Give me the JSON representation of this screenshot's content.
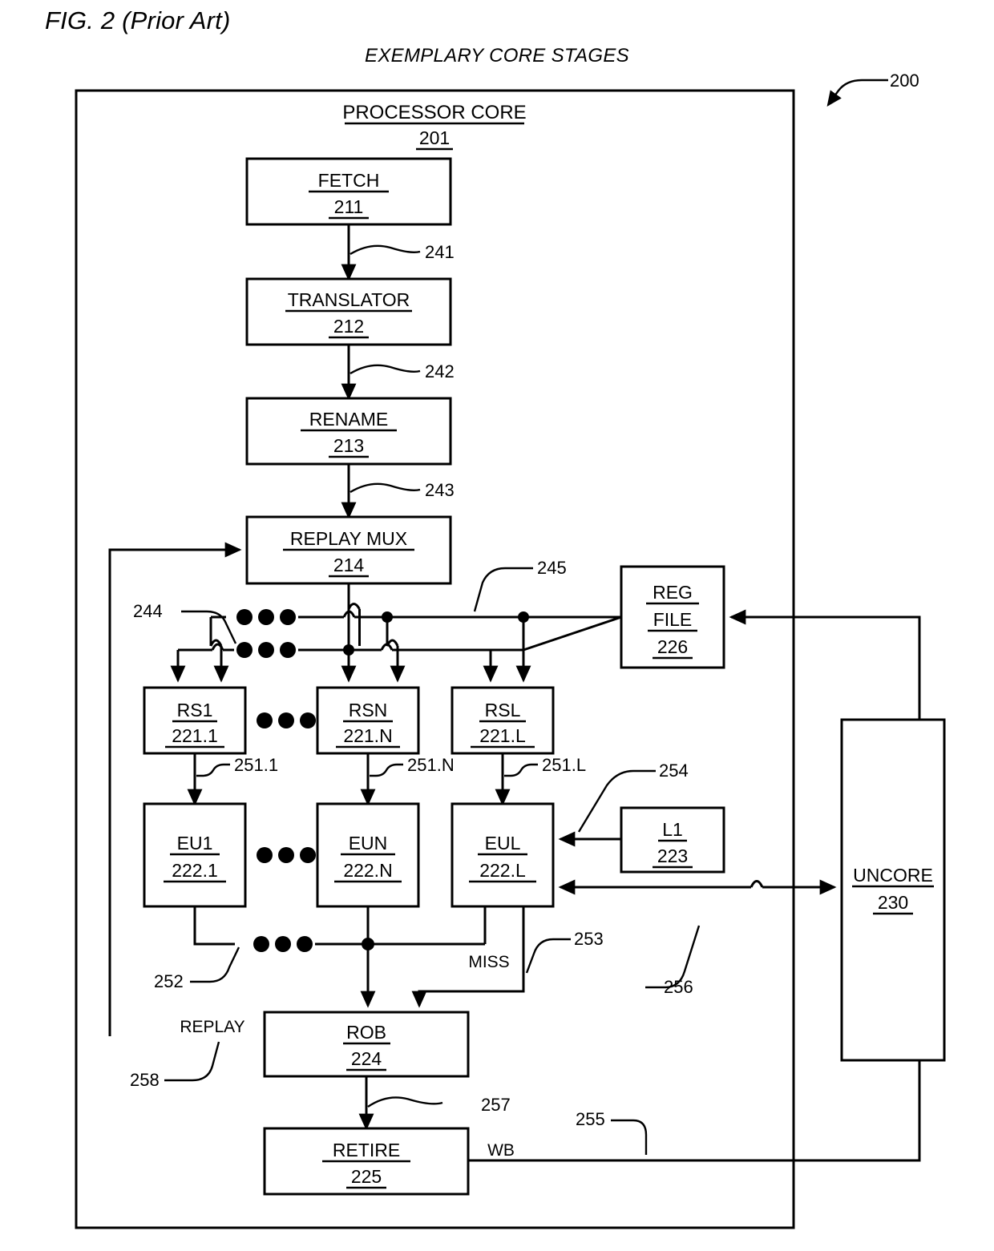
{
  "figure": {
    "label": "FIG. 2 (Prior Art)",
    "title": "EXEMPLARY CORE STAGES",
    "diagram_ref": "200"
  },
  "core": {
    "name": "PROCESSOR CORE",
    "ref": "201"
  },
  "blocks": {
    "fetch": {
      "name": "FETCH",
      "ref": "211"
    },
    "translator": {
      "name": "TRANSLATOR",
      "ref": "212"
    },
    "rename": {
      "name": "RENAME",
      "ref": "213"
    },
    "replay_mux": {
      "name": "REPLAY MUX",
      "ref": "214"
    },
    "rs1": {
      "name": "RS1",
      "ref": "221.1"
    },
    "rsn": {
      "name": "RSN",
      "ref": "221.N"
    },
    "rsl": {
      "name": "RSL",
      "ref": "221.L"
    },
    "eu1": {
      "name": "EU1",
      "ref": "222.1"
    },
    "eun": {
      "name": "EUN",
      "ref": "222.N"
    },
    "eul": {
      "name": "EUL",
      "ref": "222.L"
    },
    "l1": {
      "name": "L1",
      "ref": "223"
    },
    "rob": {
      "name": "ROB",
      "ref": "224"
    },
    "retire": {
      "name": "RETIRE",
      "ref": "225"
    },
    "reg_file": {
      "name_line1": "REG",
      "name_line2": "FILE",
      "ref": "226"
    },
    "uncore": {
      "name": "UNCORE",
      "ref": "230"
    }
  },
  "connectors": {
    "c241": "241",
    "c242": "242",
    "c243": "243",
    "c244": "244",
    "c245": "245",
    "c251_1": "251.1",
    "c251_n": "251.N",
    "c251_l": "251.L",
    "c252": "252",
    "c253": "253",
    "c254": "254",
    "c255": "255",
    "c256": "256",
    "c257": "257",
    "c258": "258"
  },
  "signals": {
    "miss": "MISS",
    "replay": "REPLAY",
    "wb": "WB"
  },
  "colors": {
    "line": "#000000",
    "background": "#ffffff",
    "text": "#000000"
  }
}
